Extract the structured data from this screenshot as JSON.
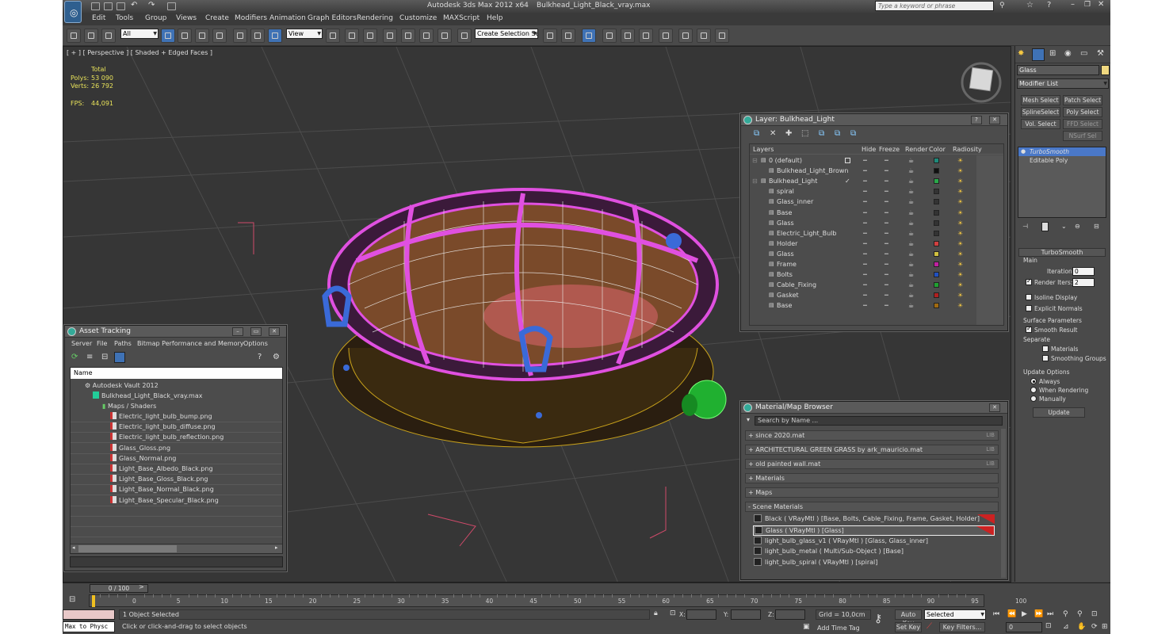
{
  "window": {
    "title": "Autodesk 3ds Max  2012 x64",
    "filename": "Bulkhead_Light_Black_vray.max",
    "search_placeholder": "Type a keyword or phrase"
  },
  "menu": [
    "Edit",
    "Tools",
    "Group",
    "Views",
    "Create",
    "Modifiers",
    "Animation",
    "Graph Editors",
    "Rendering",
    "Customize",
    "MAXScript",
    "Help"
  ],
  "toolbar": {
    "filter": "All",
    "refcoord": "View",
    "selection_set": "Create Selection Se"
  },
  "viewport": {
    "label": "[ + ] [ Perspective ] [ Shaded + Edged Faces ]",
    "stats_header": "Total",
    "polys_label": "Polys:",
    "polys": "53 090",
    "verts_label": "Verts:",
    "verts": "26 792",
    "fps_label": "FPS:",
    "fps": "44,091"
  },
  "layer_panel": {
    "title": "Layer: Bulkhead_Light",
    "columns": [
      "Layers",
      "Hide",
      "Freeze",
      "Render",
      "Color",
      "Radiosity"
    ],
    "rows": [
      {
        "name": "0 (default)",
        "level": 0,
        "color": "#1e8a7a"
      },
      {
        "name": "Bulkhead_Light_Brown",
        "level": 1,
        "color": "#111111"
      },
      {
        "name": "Bulkhead_Light",
        "level": 0,
        "color": "#2aa84a"
      },
      {
        "name": "spiral",
        "level": 1,
        "color": "#333333"
      },
      {
        "name": "Glass_inner",
        "level": 1,
        "color": "#333333"
      },
      {
        "name": "Base",
        "level": 1,
        "color": "#333333"
      },
      {
        "name": "Glass",
        "level": 1,
        "color": "#333333"
      },
      {
        "name": "Electric_Light_Bulb",
        "level": 1,
        "color": "#333333"
      },
      {
        "name": "Holder",
        "level": 1,
        "color": "#d04040"
      },
      {
        "name": "Glass",
        "level": 1,
        "color": "#d0c040"
      },
      {
        "name": "Frame",
        "level": 1,
        "color": "#c020a0"
      },
      {
        "name": "Bolts",
        "level": 1,
        "color": "#2050c0"
      },
      {
        "name": "Cable_Fixing",
        "level": 1,
        "color": "#20a030"
      },
      {
        "name": "Gasket",
        "level": 1,
        "color": "#b02020"
      },
      {
        "name": "Base",
        "level": 1,
        "color": "#a06a10"
      }
    ]
  },
  "asset_panel": {
    "title": "Asset Tracking",
    "menu": [
      "Server",
      "File",
      "Paths",
      "Bitmap Performance and Memory",
      "Options"
    ],
    "column": "Name",
    "root": "Autodesk Vault 2012",
    "file": "Bulkhead_Light_Black_vray.max",
    "maps_folder": "Maps / Shaders",
    "maps": [
      "Electric_light_bulb_bump.png",
      "Electric_light_bulb_diffuse.png",
      "Electric_light_bulb_reflection.png",
      "Glass_Gloss.png",
      "Glass_Normal.png",
      "Light_Base_Albedo_Black.png",
      "Light_Base_Gloss_Black.png",
      "Light_Base_Normal_Black.png",
      "Light_Base_Specular_Black.png"
    ]
  },
  "material_panel": {
    "title": "Material/Map Browser",
    "search_placeholder": "Search by Name ...",
    "libraries": [
      "+ since 2020.mat",
      "+ ARCHITECTURAL GREEN GRASS by ark_mauricio.mat",
      "+ old painted wall.mat"
    ],
    "lib_tag": "LIB",
    "groups": [
      "+ Materials",
      "+ Maps",
      "- Scene Materials"
    ],
    "scene_materials": [
      "Black  ( VRayMtl ) [Base, Bolts, Cable_Fixing, Frame, Gasket, Holder]",
      "Glass  ( VRayMtl ) [Glass]",
      "light_bulb_glass_v1  ( VRayMtl ) [Glass, Glass_inner]",
      "light_bulb_metal  ( Multi/Sub-Object ) [Base]",
      "light_bulb_spiral  ( VRayMtl ) [spiral]"
    ]
  },
  "command_panel": {
    "object_name": "Glass",
    "modifier_list": "Modifier List",
    "buttons": [
      "Mesh Select",
      "Patch Select",
      "SplineSelect",
      "Poly Select",
      "Vol. Select",
      "FFD Select",
      "NSurf Sel"
    ],
    "stack": [
      "TurboSmooth",
      "Editable Poly"
    ],
    "rollout_title": "TurboSmooth",
    "main": "Main",
    "iterations_label": "Iterations:",
    "iterations": "0",
    "render_iters_label": "Render Iters:",
    "render_iters": "2",
    "isoline": "Isoline Display",
    "explicit": "Explicit Normals",
    "surface": "Surface Parameters",
    "smooth_result": "Smooth Result",
    "separate": "Separate",
    "materials": "Materials",
    "smoothing_groups": "Smoothing Groups",
    "update_options": "Update Options",
    "always": "Always",
    "when_rendering": "When Rendering",
    "manually": "Manually",
    "update_btn": "Update"
  },
  "timeline": {
    "frame": "0 / 100",
    "ticks": [
      "0",
      "5",
      "10",
      "15",
      "20",
      "25",
      "30",
      "35",
      "40",
      "45",
      "50",
      "55",
      "60",
      "65",
      "70",
      "75",
      "80",
      "85",
      "90",
      "95",
      "100"
    ]
  },
  "status": {
    "script_listener": "Max to Physc",
    "selected": "1 Object Selected",
    "prompt": "Click or click-and-drag to select objects",
    "x_label": "X:",
    "y_label": "Y:",
    "z_label": "Z:",
    "grid": "Grid = 10,0cm",
    "add_time_tag": "Add Time Tag",
    "auto_key": "Auto Key",
    "set_key": "Set Key",
    "selected_combo": "Selected",
    "key_filters": "Key Filters...",
    "frame_value": "0"
  }
}
